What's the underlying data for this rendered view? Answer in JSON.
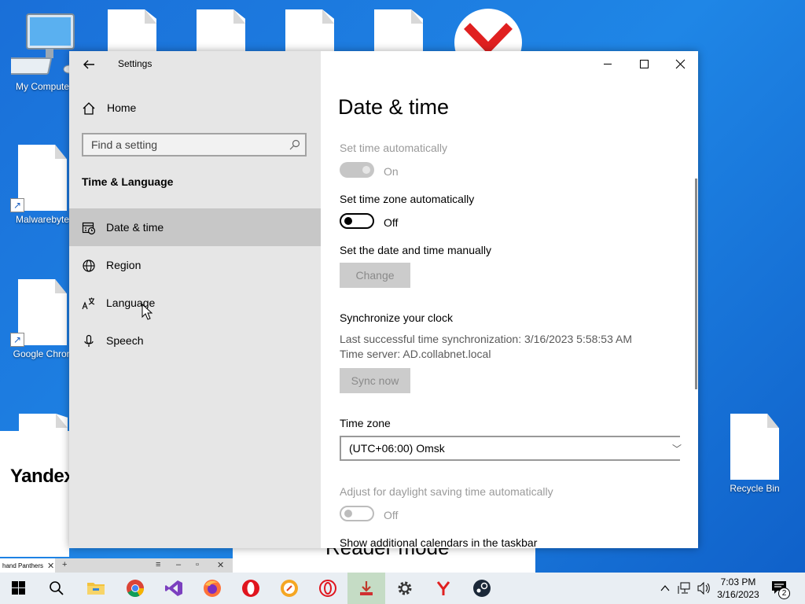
{
  "desktop": {
    "icons": [
      {
        "label": "My Compute"
      },
      {
        "label": "Malwarebyte"
      },
      {
        "label": "Google Chron"
      },
      {
        "label": "Recycle Bin"
      }
    ],
    "background_text": {
      "yandex": "Yandex",
      "reader_mode": "Reader mode",
      "browser_tab": "hand Panthers"
    }
  },
  "settings": {
    "window_title": "Settings",
    "home_label": "Home",
    "search_placeholder": "Find a setting",
    "section": "Time & Language",
    "nav": [
      {
        "label": "Date & time",
        "icon": "date-time-icon",
        "active": true
      },
      {
        "label": "Region",
        "icon": "globe-icon"
      },
      {
        "label": "Language",
        "icon": "language-icon"
      },
      {
        "label": "Speech",
        "icon": "microphone-icon"
      }
    ],
    "page_title": "Date & time",
    "set_time_auto": {
      "label": "Set time automatically",
      "state": "On"
    },
    "set_tz_auto": {
      "label": "Set time zone automatically",
      "state": "Off"
    },
    "manual": {
      "label": "Set the date and time manually",
      "button": "Change"
    },
    "sync": {
      "title": "Synchronize your clock",
      "last": "Last successful time synchronization: 3/16/2023 5:58:53 AM",
      "server": "Time server: AD.collabnet.local",
      "button": "Sync now"
    },
    "timezone": {
      "label": "Time zone",
      "value": "(UTC+06:00) Omsk"
    },
    "dst": {
      "label": "Adjust for daylight saving time automatically",
      "state": "Off"
    },
    "calendars_label": "Show additional calendars in the taskbar"
  },
  "taskbar": {
    "time": "7:03 PM",
    "date": "3/16/2023",
    "notification_count": "2"
  },
  "colors": {
    "desktop": "#1a6fd8",
    "sidebar": "#e6e6e6",
    "active_nav": "#c7c7c7",
    "taskbar": "#e9eef3"
  }
}
